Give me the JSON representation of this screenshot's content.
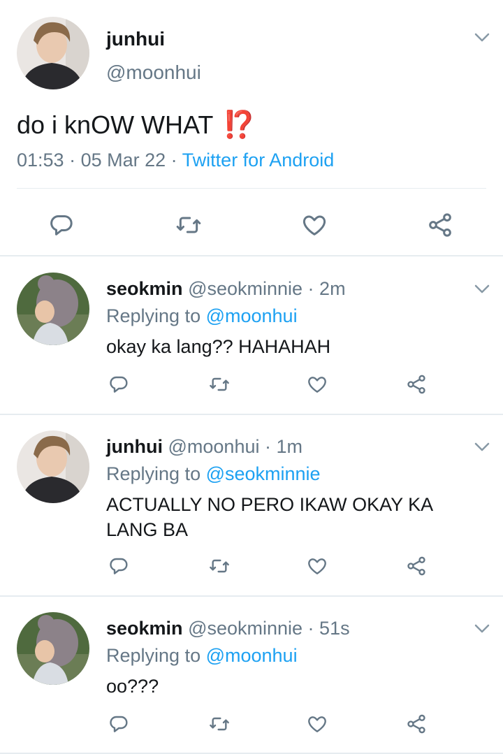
{
  "main_tweet": {
    "name": "junhui",
    "handle": "@moonhui",
    "text": "do i knOW WHAT",
    "emoji": "⁉️",
    "time": "01:53",
    "date": "05 Mar 22",
    "client": "Twitter for Android",
    "meta_separator": " · "
  },
  "replies": [
    {
      "name": "seokmin",
      "handle": "@seokminnie",
      "age": "2m",
      "replying_label": "Replying to ",
      "replying_to": "@moonhui",
      "text": "okay ka lang?? HAHAHAH"
    },
    {
      "name": "junhui",
      "handle": "@moonhui",
      "age": "1m",
      "replying_label": "Replying to ",
      "replying_to": "@seokminnie",
      "text": "ACTUALLY NO PERO IKAW OKAY KA LANG BA"
    },
    {
      "name": "seokmin",
      "handle": "@seokminnie",
      "age": "51s",
      "replying_label": "Replying to ",
      "replying_to": "@moonhui",
      "text": "oo???"
    }
  ],
  "separator_dot": " · ",
  "icons": [
    "reply-icon",
    "retweet-icon",
    "like-icon",
    "share-icon",
    "chevron-down-icon"
  ],
  "colors": {
    "text": "#14171a",
    "secondary": "#657786",
    "link": "#1da1f2",
    "divider": "#e6ecf0"
  }
}
